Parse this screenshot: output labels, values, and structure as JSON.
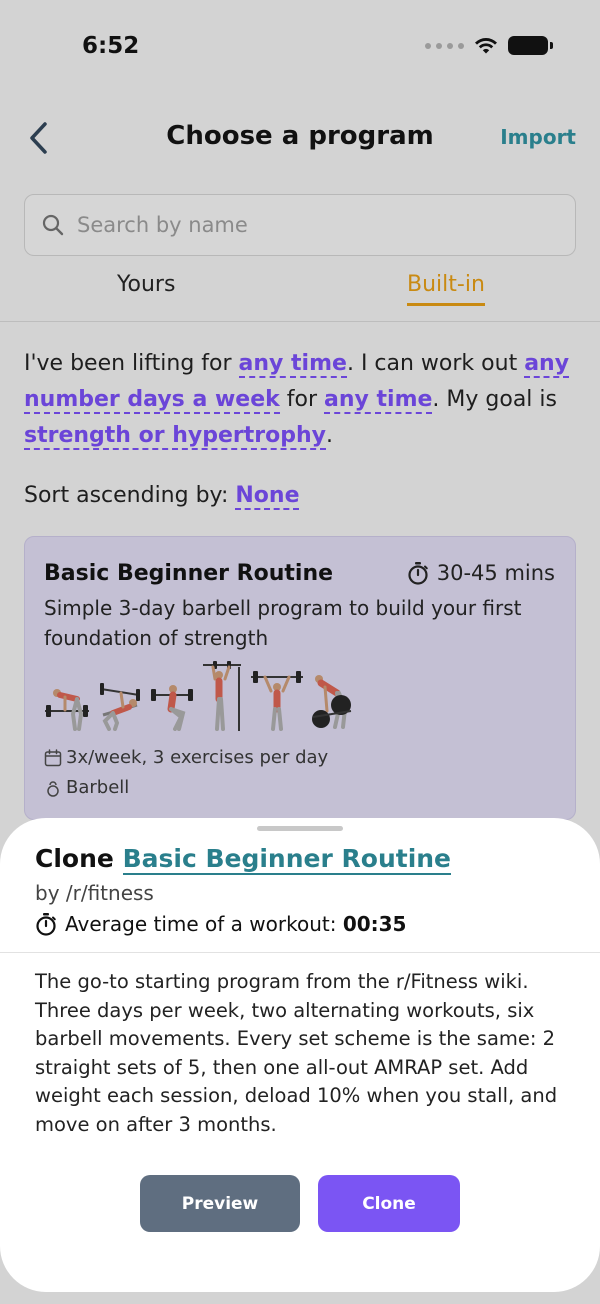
{
  "status_bar": {
    "time": "6:52"
  },
  "nav": {
    "title": "Choose a program",
    "import_label": "Import"
  },
  "search": {
    "placeholder": "Search by name"
  },
  "tabs": {
    "yours": "Yours",
    "builtin": "Built-in"
  },
  "filter": {
    "p1": "I've been lifting for ",
    "experience": "any time",
    "p2": ". I can work out ",
    "days": "any number days a week",
    "p3": " for ",
    "duration": "any time",
    "p4": ". My goal is ",
    "goal": "strength or hypertrophy",
    "p5": "."
  },
  "sort": {
    "label": "Sort ascending by: ",
    "value": "None"
  },
  "program_card": {
    "title": "Basic Beginner Routine",
    "time": "30-45 mins",
    "description": "Simple 3-day barbell program to build your first foundation of strength",
    "frequency": "3x/week, 3 exercises per day",
    "equipment": "Barbell",
    "exercises": [
      "barbell-row",
      "bench-press",
      "squat",
      "overhead-press",
      "push-press",
      "deadlift"
    ]
  },
  "sheet": {
    "prefix": "Clone ",
    "program_name": "Basic Beginner Routine",
    "author": "by /r/fitness",
    "avg_label": "Average time of a workout: ",
    "avg_value": "00:35",
    "body": "The go-to starting program from the r/Fitness wiki. Three days per week, two alternating workouts, six barbell movements. Every set scheme is the same: 2 straight sets of 5, then one all-out AMRAP set. Add weight each session, deload 10% when you stall, and move on after 3 months.",
    "preview_label": "Preview",
    "clone_label": "Clone"
  },
  "colors": {
    "accent_purple": "#7b55f3",
    "link_teal": "#2a7f8c",
    "tab_gold": "#c98a12",
    "preview_gray": "#5f6e80"
  }
}
